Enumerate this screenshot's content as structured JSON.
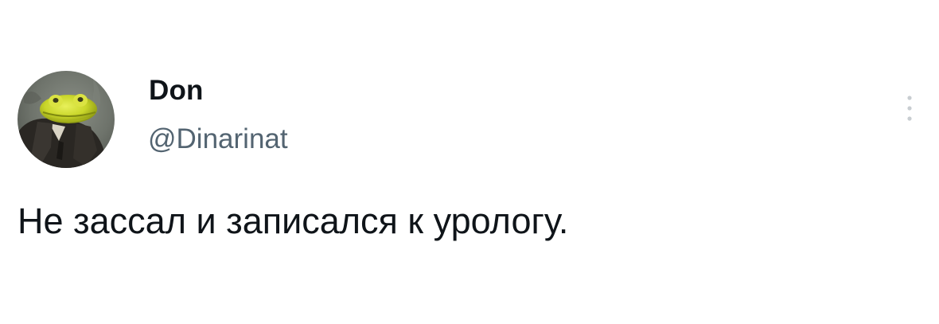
{
  "tweet": {
    "author": {
      "display_name": "Don",
      "handle": "@Dinarinat",
      "avatar_icon": "frog-avatar-icon"
    },
    "more_icon": "more-vertical-icon",
    "text": "Не зассал и записался к урологу."
  },
  "colors": {
    "background": "#ffffff",
    "primary_text": "#0f1419",
    "secondary_text": "#536471",
    "more_icon": "#c8cdd1"
  }
}
